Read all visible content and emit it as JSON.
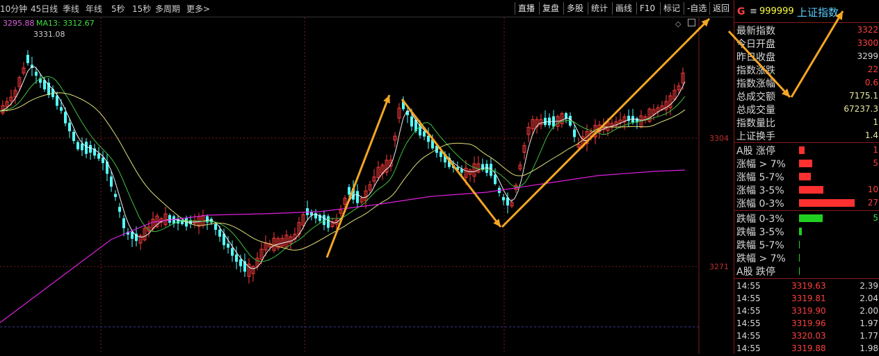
{
  "period_tabs": [
    "10分钟",
    "45日线",
    "季线",
    "年线",
    "5秒",
    "15秒",
    "多周期",
    "更多>"
  ],
  "toolbar": [
    "直播",
    "复盘",
    "多股",
    "统计",
    "画线",
    "F10",
    "标记",
    "-自选",
    "返回"
  ],
  "legend": {
    "ma1": "3295.88",
    "ma2": "MA13: 3312.67",
    "peak_label": "3331.08"
  },
  "axis": {
    "y_high_label": "3304",
    "y_low_label": "3271"
  },
  "colors": {
    "up": "#ff3c3c",
    "down": "#54ffff",
    "ma_white": "#f0f0f0",
    "ma_green": "#40c040",
    "ma_yellow": "#e0e07a",
    "ma_magenta": "#e020e0",
    "arrow": "#f5a623"
  },
  "header": {
    "letter": "G",
    "menu_icon": "menu-icon",
    "code": "999999",
    "name": "上证指数"
  },
  "quote": [
    {
      "label": "最新指数",
      "value": "3322"
    },
    {
      "label": "今日开盘",
      "value": "3300"
    },
    {
      "label": "昨日收盘",
      "value": "3299"
    },
    {
      "label": "指数涨跌",
      "value": "22"
    },
    {
      "label": "指数涨幅",
      "value": "0.6"
    },
    {
      "label": "总成交额",
      "value": "7175.1"
    },
    {
      "label": "总成交量",
      "value": "67237.3"
    },
    {
      "label": "指数量比",
      "value": "1"
    },
    {
      "label": "上证换手",
      "value": "1.4"
    }
  ],
  "up_dist": [
    {
      "label": "A股 涨停",
      "value": "1",
      "level": 0.1
    },
    {
      "label": "涨幅 > 7%",
      "value": "5",
      "level": 0.23
    },
    {
      "label": "涨幅 5-7%",
      "value": "",
      "level": 0.2
    },
    {
      "label": "涨幅 3-5%",
      "value": "10",
      "level": 0.42
    },
    {
      "label": "涨幅 0-3%",
      "value": "27",
      "level": 0.95
    }
  ],
  "down_dist": [
    {
      "label": "跌幅 0-3%",
      "value": "5",
      "level": 0.4
    },
    {
      "label": "跌幅 3-5%",
      "value": "",
      "level": 0.05
    },
    {
      "label": "跌幅 5-7%",
      "value": "",
      "level": 0.01
    },
    {
      "label": "跌幅 > 7%",
      "value": "",
      "level": 0.01
    },
    {
      "label": "A股 跌停",
      "value": "",
      "level": 0.01
    }
  ],
  "ticks": [
    {
      "time": "14:55",
      "price": "3319.63",
      "vol": "2.39"
    },
    {
      "time": "14:55",
      "price": "3319.81",
      "vol": "2.04"
    },
    {
      "time": "14:55",
      "price": "3319.90",
      "vol": "2.00"
    },
    {
      "time": "14:55",
      "price": "3319.96",
      "vol": "1.97"
    },
    {
      "time": "14:55",
      "price": "3320.03",
      "vol": "1.77"
    },
    {
      "time": "14:55",
      "price": "3319.88",
      "vol": "1.98"
    }
  ]
}
